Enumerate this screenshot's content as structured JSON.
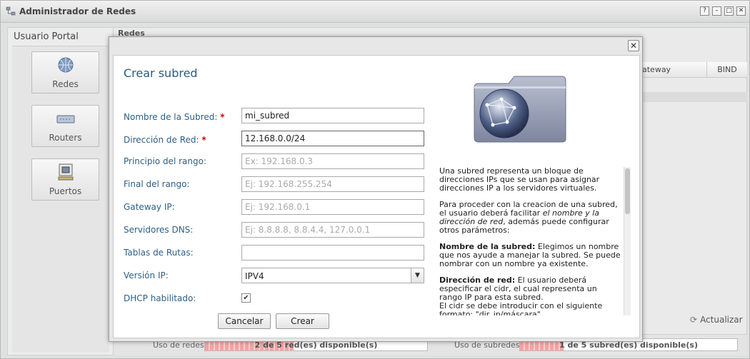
{
  "window": {
    "title": "Administrador de Redes",
    "controls": [
      "?",
      "–",
      "□",
      "✕"
    ]
  },
  "portal": {
    "title": "Usuario Portal",
    "tiles": [
      {
        "label": "Redes",
        "icon": "globe-icon"
      },
      {
        "label": "Routers",
        "icon": "router-icon"
      },
      {
        "label": "Puertos",
        "icon": "port-icon"
      }
    ]
  },
  "background": {
    "panel_title": "Redes",
    "columns": [
      "Gateway",
      "BIND"
    ],
    "gateway_fragment": "ateway",
    "refresh_label": "Actualizar",
    "usage_networks_label": "Uso de redes:",
    "usage_networks_value": "2 de 5 red(es) disponible(s)",
    "usage_subnets_label": "Uso de subredes:",
    "usage_subnets_value": "1 de 5 subred(es) disponible(s)"
  },
  "modal": {
    "title": "Crear subred",
    "close_glyph": "✕",
    "fields": {
      "name": {
        "label": "Nombre de la Subred:",
        "value": "mi_subred",
        "required": true
      },
      "network": {
        "label": "Dirección de Red:",
        "value": "12.168.0.0/24",
        "required": true
      },
      "range_start": {
        "label": "Principio del rango:",
        "placeholder": "Ex: 192.168.0.3"
      },
      "range_end": {
        "label": "Final del rango:",
        "placeholder": "Ej: 192.168.255.254"
      },
      "gateway": {
        "label": "Gateway IP:",
        "placeholder": "Ej: 192.168.0.1"
      },
      "dns": {
        "label": "Servidores DNS:",
        "placeholder": "Ej: 8.8.8.8, 8.8.4.4, 127.0.0.1"
      },
      "routes": {
        "label": "Tablas de Rutas:",
        "value": ""
      },
      "ip_version": {
        "label": "Versión IP:",
        "value": "IPV4"
      },
      "dhcp": {
        "label": "DHCP habilitado:",
        "checked": true
      }
    },
    "required_mark": "*",
    "buttons": {
      "cancel": "Cancelar",
      "create": "Crear"
    },
    "help": {
      "p1": "Una subred representa un bloque de direcciones IPs que se usan para asignar direcciones IP a los servidores virtuales.",
      "p2_start": "Para proceder con la creacion de una subred, el usuario deberá facilitar ",
      "p2_em": "el nombre y la dirección de red",
      "p2_end": ", además puede configurar otros parámetros:",
      "p3_bold": "Nombre de la subred:",
      "p3_text": " Elegimos un nombre que nos ayude a manejar la subred. Se puede nombrar con un nombre ya existente.",
      "p4_bold": "Dirección de red:",
      "p4_text": " El usuario deberá especificar el cidr, el cual representa un rango IP para esta subred.",
      "p4_line2": "El cidr se debe introducir con el siguiente formato: \"dir_ip/máscara\""
    }
  },
  "colors": {
    "accent_text": "#2d5f86",
    "title_blue": "#2b5b80",
    "required_red": "#cc0000",
    "usage_bar": "#f4a4a4"
  },
  "usage": {
    "networks_fraction": 0.4,
    "subnets_fraction": 0.2
  }
}
